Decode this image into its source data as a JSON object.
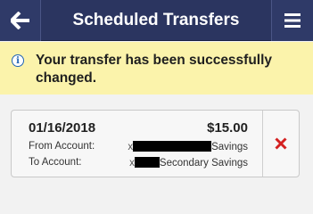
{
  "header": {
    "title": "Scheduled Transfers",
    "back_icon": "arrow-left-icon",
    "menu_icon": "hamburger-menu-icon"
  },
  "alert": {
    "icon": "info-icon",
    "icon_glyph": "i",
    "message": "Your transfer has been successfully changed."
  },
  "transfer": {
    "date": "01/16/2018",
    "amount": "$15.00",
    "from_label": "From Account:",
    "from_prefix": "x",
    "from_value": "Savings",
    "to_label": "To Account:",
    "to_prefix": "x",
    "to_value": "Secondary Savings",
    "delete_icon": "delete-x-icon"
  },
  "colors": {
    "header_bg": "#2b3560",
    "alert_bg": "#fbf3ab",
    "delete_red": "#d42020"
  }
}
